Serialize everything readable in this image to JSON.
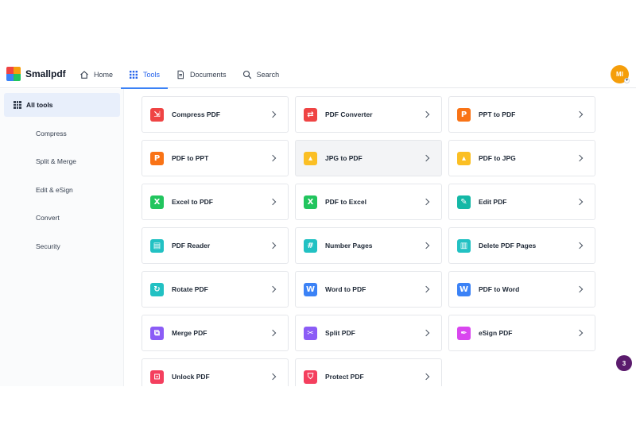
{
  "brand": {
    "name": "Smallpdf",
    "colors": [
      "#ef4444",
      "#f59e0b",
      "#22c55e",
      "#3b82f6"
    ]
  },
  "nav": [
    {
      "label": "Home",
      "icon": "home-icon"
    },
    {
      "label": "Tools",
      "icon": "grid-icon",
      "active": true
    },
    {
      "label": "Documents",
      "icon": "document-icon"
    },
    {
      "label": "Search",
      "icon": "search-icon"
    }
  ],
  "user": {
    "initials": "MI",
    "caret": "▾"
  },
  "sidebar": {
    "items": [
      {
        "label": "All tools",
        "active": true
      },
      {
        "label": "Compress"
      },
      {
        "label": "Split & Merge"
      },
      {
        "label": "Edit & eSign"
      },
      {
        "label": "Convert"
      },
      {
        "label": "Security"
      }
    ]
  },
  "tools": [
    {
      "label": "Compress PDF",
      "icon": "compress-icon",
      "color": "#ef4444",
      "glyph": "⇲"
    },
    {
      "label": "PDF Converter",
      "icon": "converter-icon",
      "color": "#ef4444",
      "glyph": "⇄"
    },
    {
      "label": "PPT to PDF",
      "icon": "ppt-icon",
      "color": "#f97316",
      "glyph": "P"
    },
    {
      "label": "PDF to PPT",
      "icon": "ppt-icon",
      "color": "#f97316",
      "glyph": "P"
    },
    {
      "label": "JPG to PDF",
      "icon": "image-icon",
      "color": "#fbbf24",
      "glyph": "▴"
    },
    {
      "label": "PDF to JPG",
      "icon": "image-icon",
      "color": "#fbbf24",
      "glyph": "▴"
    },
    {
      "label": "Excel to PDF",
      "icon": "excel-icon",
      "color": "#22c55e",
      "glyph": "X"
    },
    {
      "label": "PDF to Excel",
      "icon": "excel-icon",
      "color": "#22c55e",
      "glyph": "X"
    },
    {
      "label": "Edit PDF",
      "icon": "edit-icon",
      "color": "#14b8a6",
      "glyph": "✎"
    },
    {
      "label": "PDF Reader",
      "icon": "reader-icon",
      "color": "#22c1c3",
      "glyph": "▤"
    },
    {
      "label": "Number Pages",
      "icon": "number-pages-icon",
      "color": "#22c1c3",
      "glyph": "#"
    },
    {
      "label": "Delete PDF Pages",
      "icon": "delete-pages-icon",
      "color": "#22c1c3",
      "glyph": "▥"
    },
    {
      "label": "Rotate PDF",
      "icon": "rotate-icon",
      "color": "#22c1c3",
      "glyph": "↻"
    },
    {
      "label": "Word to PDF",
      "icon": "word-icon",
      "color": "#3b82f6",
      "glyph": "W"
    },
    {
      "label": "PDF to Word",
      "icon": "word-icon",
      "color": "#3b82f6",
      "glyph": "W"
    },
    {
      "label": "Merge PDF",
      "icon": "merge-icon",
      "color": "#8b5cf6",
      "glyph": "⧉"
    },
    {
      "label": "Split PDF",
      "icon": "split-icon",
      "color": "#8b5cf6",
      "glyph": "✂"
    },
    {
      "label": "eSign PDF",
      "icon": "esign-icon",
      "color": "#d946ef",
      "glyph": "✒"
    },
    {
      "label": "Unlock PDF",
      "icon": "unlock-icon",
      "color": "#f43f5e",
      "glyph": "⊡"
    },
    {
      "label": "Protect PDF",
      "icon": "protect-icon",
      "color": "#f43f5e",
      "glyph": "⛉"
    }
  ],
  "notification_count": "3"
}
